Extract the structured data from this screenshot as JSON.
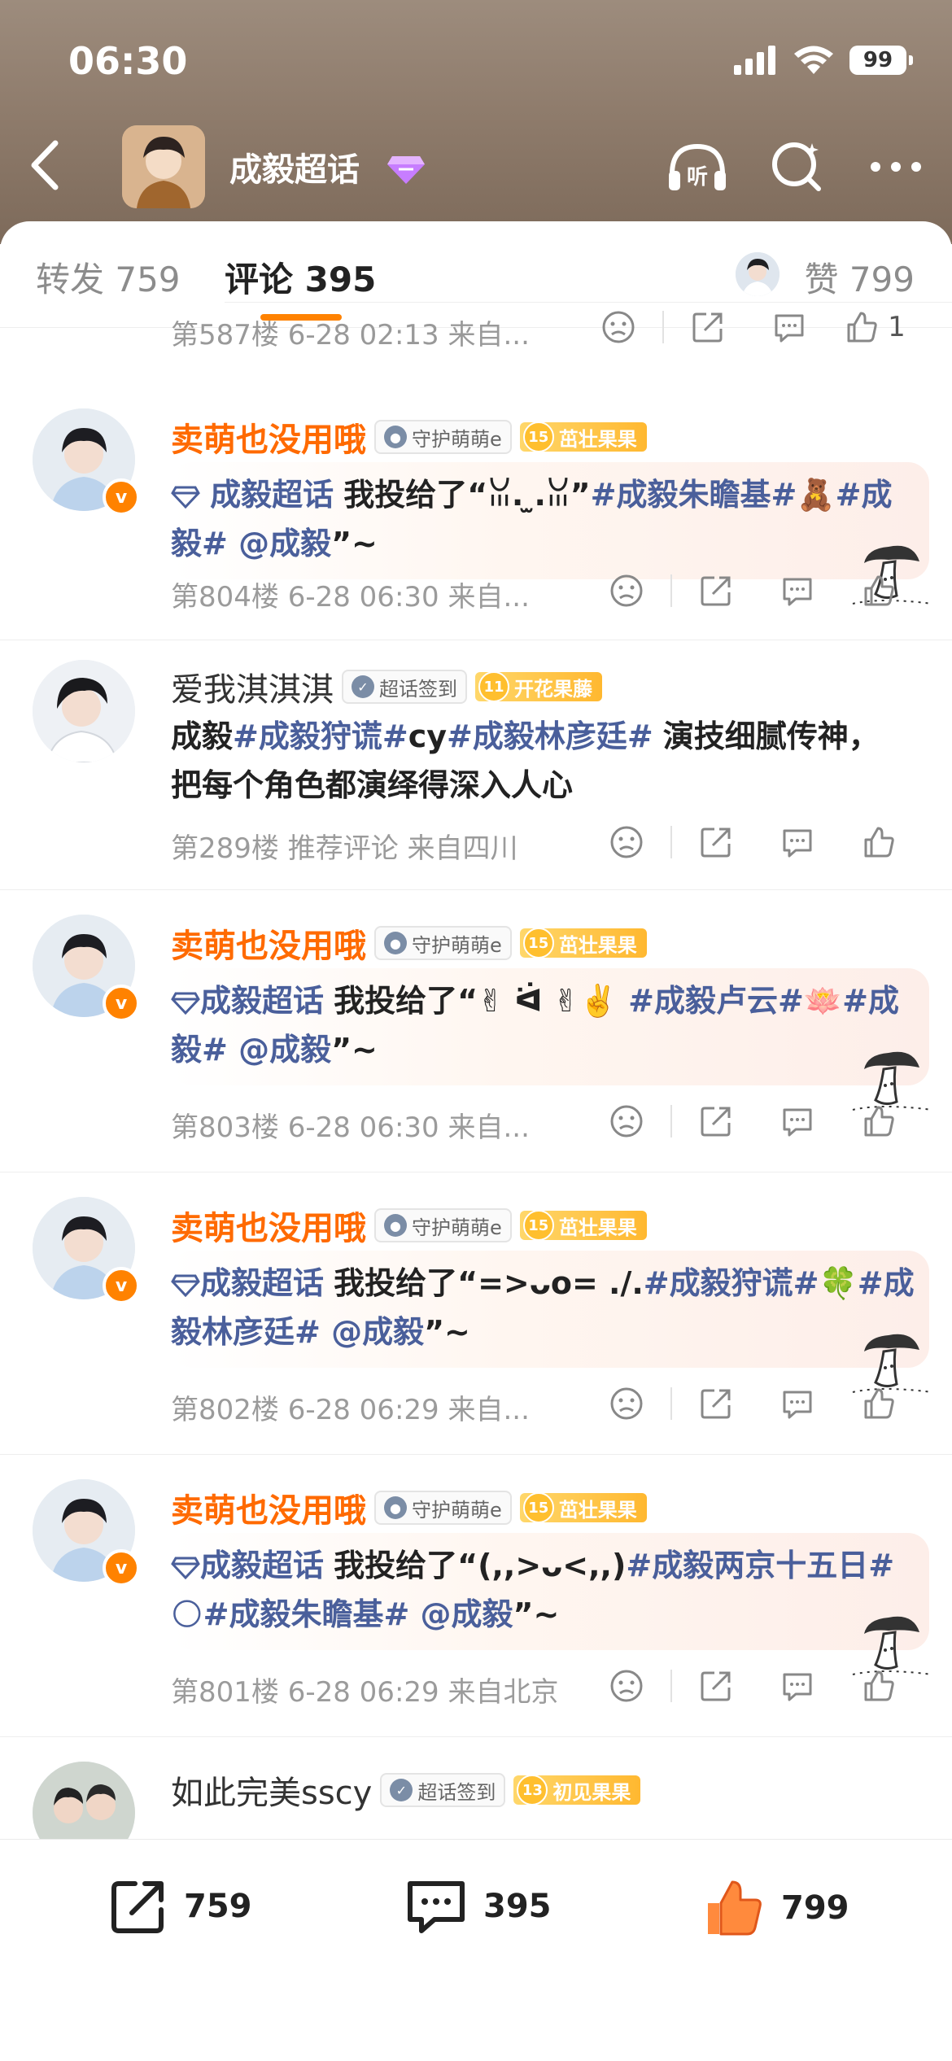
{
  "status_bar": {
    "time": "06:30",
    "battery": "99"
  },
  "nav": {
    "title": "成毅超话",
    "listen_label": "听"
  },
  "tabs": {
    "repost": "转发 759",
    "comment": "评论 395",
    "like": "赞 799"
  },
  "previous_meta": {
    "text": "第587楼 6-28 02:13 来自...",
    "like_count": "1"
  },
  "comments": [
    {
      "name": "卖萌也没用哦",
      "tag": "守护萌萌e",
      "level": "15",
      "level_label": "茁壮果果",
      "link": "成毅超话",
      "text_a": "我投给了“ꈍ. ̫.ꈍ”",
      "tags": "#成毅朱瞻基#🧸#成毅# @成毅",
      "text_b": "”~",
      "meta": "第804楼 6-28 06:30 来自..."
    },
    {
      "name": "爱我淇淇淇",
      "tag": "超话签到",
      "level": "11",
      "level_label": "开花果藤",
      "p1": "成毅",
      "p2": "#成毅狩谎#",
      "p3": "cy",
      "p4": "#成毅林彦廷#",
      "p5": "演技细腻传神，把每个角色都演绎得深入人心",
      "meta": "第289楼 推荐评论 来自四川"
    },
    {
      "name": "卖萌也没用哦",
      "tag": "守护萌萌e",
      "level": "15",
      "level_label": "茁壮果果",
      "link": "成毅超话",
      "text_a": "我投给了“✌︎ ᐛ ✌︎",
      "tags": "✌️ #成毅卢云#🪷#成毅# @成毅",
      "text_b": "”~",
      "meta": "第803楼 6-28 06:30 来自..."
    },
    {
      "name": "卖萌也没用哦",
      "tag": "守护萌萌e",
      "level": "15",
      "level_label": "茁壮果果",
      "link": "成毅超话",
      "text_a": "我投给了“=>ᴗo= ./.",
      "tags": "#成毅狩谎#🍀#成毅林彦廷# @成毅",
      "text_b": "”~",
      "meta": "第802楼 6-28 06:29 来自..."
    },
    {
      "name": "卖萌也没用哦",
      "tag": "守护萌萌e",
      "level": "15",
      "level_label": "茁壮果果",
      "link": "成毅超话",
      "text_a": "我投给了“(,,>ᴗ<,,)",
      "tags": "#成毅两京十五日#🌕#成毅朱瞻基# @成毅",
      "text_b": "”~",
      "meta": "第801楼 6-28 06:29 来自北京"
    },
    {
      "name": "如此完美sscy",
      "tag": "超话签到",
      "level": "13",
      "level_label": "初见果果"
    }
  ],
  "bottom_bar": {
    "repost": "759",
    "comment": "395",
    "like": "799"
  },
  "colors": {
    "accent": "#ff8200",
    "name": "#ff6a00",
    "topic": "#4a5f9b"
  }
}
